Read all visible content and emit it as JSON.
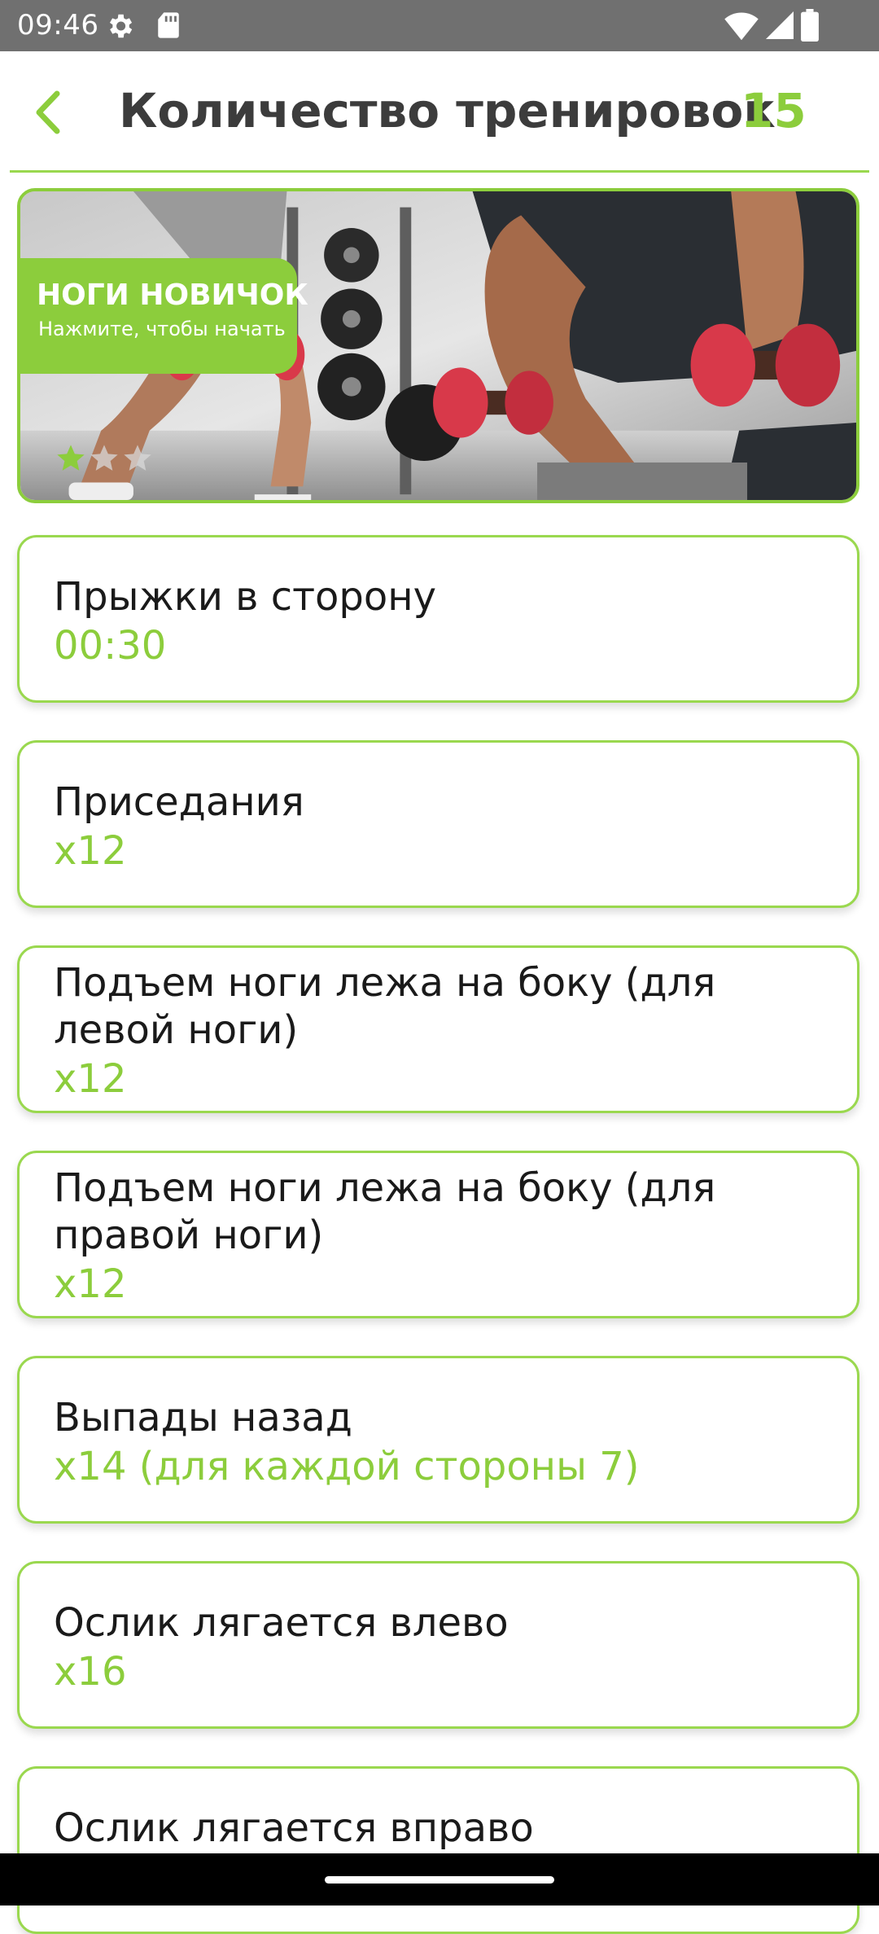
{
  "status_bar": {
    "time": "09:46"
  },
  "header": {
    "title": "Количество тренировок",
    "count": "15",
    "accent_color": "#8ccd3c"
  },
  "banner": {
    "title": "НОГИ НОВИЧОК",
    "subtitle": "Нажмите, чтобы начать",
    "rating": {
      "filled": 1,
      "total": 3
    }
  },
  "exercises": [
    {
      "name": "Прыжки в сторону",
      "value": "00:30"
    },
    {
      "name": "Приседания",
      "value": "x12"
    },
    {
      "name": "Подъем ноги лежа на боку (для левой ноги)",
      "value": "x12"
    },
    {
      "name": "Подъем ноги лежа на боку (для правой ноги)",
      "value": "x12"
    },
    {
      "name": "Выпады назад",
      "value": "x14 (для каждой стороны 7)"
    },
    {
      "name": "Ослик лягается влево",
      "value": "x16"
    },
    {
      "name": "Ослик лягается вправо",
      "value": ""
    }
  ]
}
